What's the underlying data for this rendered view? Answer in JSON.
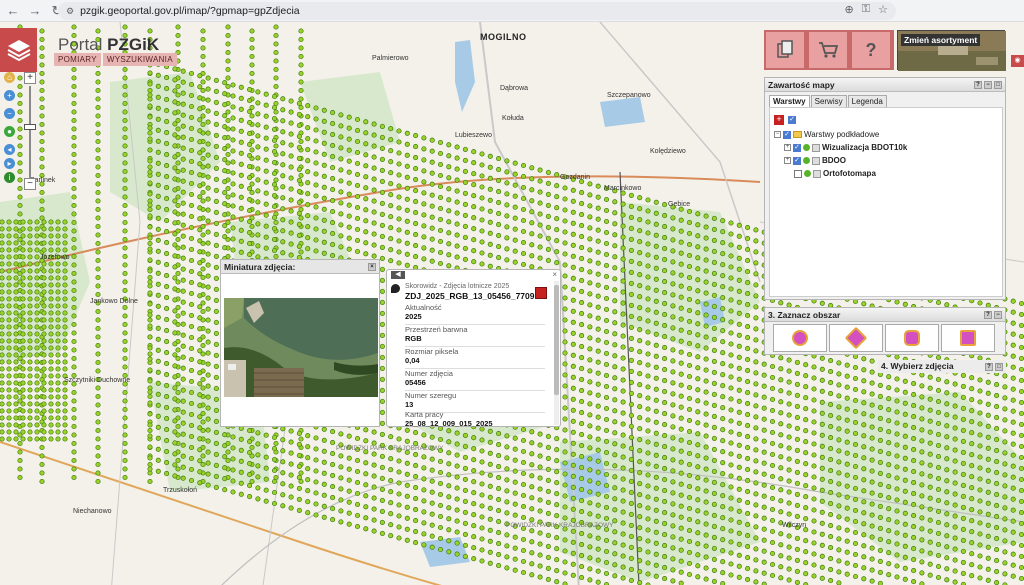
{
  "browser": {
    "url": "pzgik.geoportal.gov.pl/imap/?gpmap=gpZdjecia"
  },
  "portal": {
    "title_prefix": "Portal",
    "title_main": "PZGiK",
    "tabs": [
      "POMIARY",
      "WYSZUKIWANIA"
    ]
  },
  "toolbar": {
    "change_assortment": "Zmień asortyment"
  },
  "layers_panel": {
    "title": "Zawartość mapy",
    "tabs": [
      "Warstwy",
      "Serwisy",
      "Legenda"
    ],
    "root": "Warstwy podkładowe",
    "items": [
      "Wizualizacja BDOT10k",
      "BDOO",
      "Ortofotomapa"
    ]
  },
  "area_panel": {
    "title": "3. Zaznacz obszar"
  },
  "pick_panel": {
    "title": "4. Wybierz zdjęcia"
  },
  "thumbnail_dialog": {
    "title": "Miniatura zdjęcia:"
  },
  "photo_info": {
    "source": "Skorowidz - Zdjęcia lotnicze 2025",
    "id": "ZDJ_2025_RGB_13_05456_7709...",
    "fields": [
      {
        "label": "Aktualność",
        "value": "2025"
      },
      {
        "label": "Przestrzeń barwna",
        "value": "RGB"
      },
      {
        "label": "Rozmiar piksela",
        "value": "0,04"
      },
      {
        "label": "Numer zdjęcia",
        "value": "05456"
      },
      {
        "label": "Numer szeregu",
        "value": "13"
      },
      {
        "label": "Karta pracy",
        "value": "25_08_12_009_015_2025"
      }
    ]
  },
  "map_labels": {
    "mogilno": "MOGILNO",
    "park1": "POWIDZKI PARK KRAJOBRAZOWY",
    "park2": "POWIDZKI PARK KRAJOBRAZOWY",
    "places": [
      "Palmierowo",
      "Dąbrowa",
      "Szczepanowo",
      "Kołuda",
      "Lubieszewo",
      "Gozdanin",
      "Kolędziewo",
      "Parlinek",
      "Józefowo",
      "Jankowo Dolne",
      "Marcinkowo",
      "Szczytniki Duchowne",
      "Gębice",
      "Niechanowo",
      "Wilczyn",
      "Trzuskołoń"
    ]
  },
  "colors": {
    "accent": "#c94a4a",
    "dot_fill": "#9bd229",
    "dot_stroke": "#3e7c0e",
    "forest": "#d7e8cc",
    "lake": "#a7cbe6"
  }
}
